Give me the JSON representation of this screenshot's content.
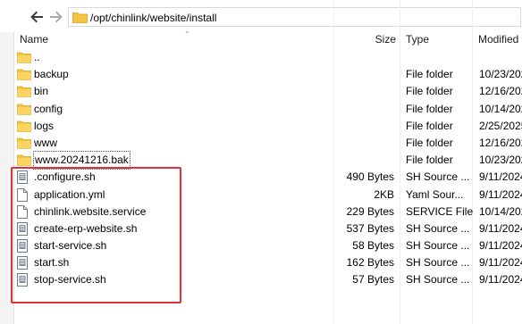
{
  "address": {
    "path": "/opt/chinlink/website/install"
  },
  "columns": {
    "name": "Name",
    "size": "Size",
    "type": "Type",
    "modified": "Modified"
  },
  "colors": {
    "folder": "#f5c242",
    "annotation": "#e0303a",
    "scriptIcon": "#6b7a8f"
  },
  "rows": [
    {
      "icon": "folder-icon",
      "name": "..",
      "size": "",
      "type": "",
      "modified": ""
    },
    {
      "icon": "folder-icon",
      "name": "backup",
      "size": "",
      "type": "File folder",
      "modified": "10/23/202"
    },
    {
      "icon": "folder-icon",
      "name": "bin",
      "size": "",
      "type": "File folder",
      "modified": "12/16/202"
    },
    {
      "icon": "folder-icon",
      "name": "config",
      "size": "",
      "type": "File folder",
      "modified": "10/14/202"
    },
    {
      "icon": "folder-icon",
      "name": "logs",
      "size": "",
      "type": "File folder",
      "modified": "2/25/2025"
    },
    {
      "icon": "folder-icon",
      "name": "www",
      "size": "",
      "type": "File folder",
      "modified": "12/16/202"
    },
    {
      "icon": "folder-icon",
      "name": "www.20241216.bak",
      "size": "",
      "type": "File folder",
      "modified": "10/23/202"
    },
    {
      "icon": "script-icon",
      "name": ".configure.sh",
      "size": "490 Bytes",
      "type": "SH Source ...",
      "modified": "9/11/2024"
    },
    {
      "icon": "document-icon",
      "name": "application.yml",
      "size": "2KB",
      "type": "Yaml Sour...",
      "modified": "9/11/2024"
    },
    {
      "icon": "document-icon",
      "name": "chinlink.website.service",
      "size": "229 Bytes",
      "type": "SERVICE File",
      "modified": "10/14/202"
    },
    {
      "icon": "script-icon",
      "name": "create-erp-website.sh",
      "size": "537 Bytes",
      "type": "SH Source ...",
      "modified": "9/11/2024"
    },
    {
      "icon": "script-icon",
      "name": "start-service.sh",
      "size": "58 Bytes",
      "type": "SH Source ...",
      "modified": "9/11/2024"
    },
    {
      "icon": "script-icon",
      "name": "start.sh",
      "size": "162 Bytes",
      "type": "SH Source ...",
      "modified": "9/11/2024"
    },
    {
      "icon": "script-icon",
      "name": "stop-service.sh",
      "size": "57 Bytes",
      "type": "SH Source ...",
      "modified": "9/11/2024"
    }
  ]
}
